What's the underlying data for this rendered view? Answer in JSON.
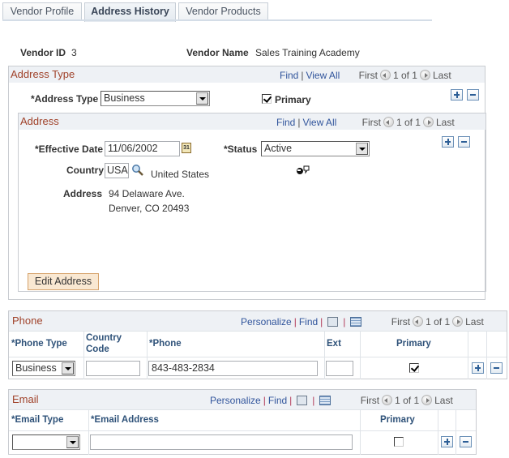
{
  "tabs": [
    {
      "label": "Vendor Profile",
      "active": false
    },
    {
      "label": "Address History",
      "active": true
    },
    {
      "label": "Vendor Products",
      "active": false
    }
  ],
  "vendor": {
    "id_label": "Vendor ID",
    "id_value": "3",
    "name_label": "Vendor Name",
    "name_value": "Sales Training Academy"
  },
  "address_type_box": {
    "title": "Address Type",
    "find": "Find",
    "view_all": "View All",
    "first": "First",
    "count": "1 of 1",
    "last": "Last",
    "field_label": "*Address Type",
    "field_value": "Business",
    "primary_label": "Primary",
    "primary_checked": true
  },
  "address_box": {
    "title": "Address",
    "find": "Find",
    "view_all": "View All",
    "first": "First",
    "count": "1 of 1",
    "last": "Last",
    "effective_date_label": "*Effective Date",
    "effective_date_value": "11/06/2002",
    "status_label": "*Status",
    "status_value": "Active",
    "country_label": "Country",
    "country_code": "USA",
    "country_name": "United States",
    "address_label": "Address",
    "address_line1": "94 Delaware Ave.",
    "address_line2": "Denver, CO 20493",
    "edit_button": "Edit Address"
  },
  "phone_grid": {
    "title": "Phone",
    "personalize": "Personalize",
    "find": "Find",
    "first": "First",
    "count": "1 of 1",
    "last": "Last",
    "headers": {
      "phone_type": "*Phone Type",
      "country_code_1": "Country",
      "country_code_2": "Code",
      "phone": "*Phone",
      "ext": "Ext",
      "primary": "Primary"
    },
    "rows": [
      {
        "phone_type": "Business",
        "country_code": "",
        "phone": "843-483-2834",
        "ext": "",
        "primary": true
      }
    ]
  },
  "email_grid": {
    "title": "Email",
    "personalize": "Personalize",
    "find": "Find",
    "first": "First",
    "count": "1 of 1",
    "last": "Last",
    "headers": {
      "email_type": "*Email Type",
      "email_address": "*Email Address",
      "primary": "Primary"
    },
    "rows": [
      {
        "email_type": "",
        "email_address": "",
        "primary": false
      }
    ]
  }
}
